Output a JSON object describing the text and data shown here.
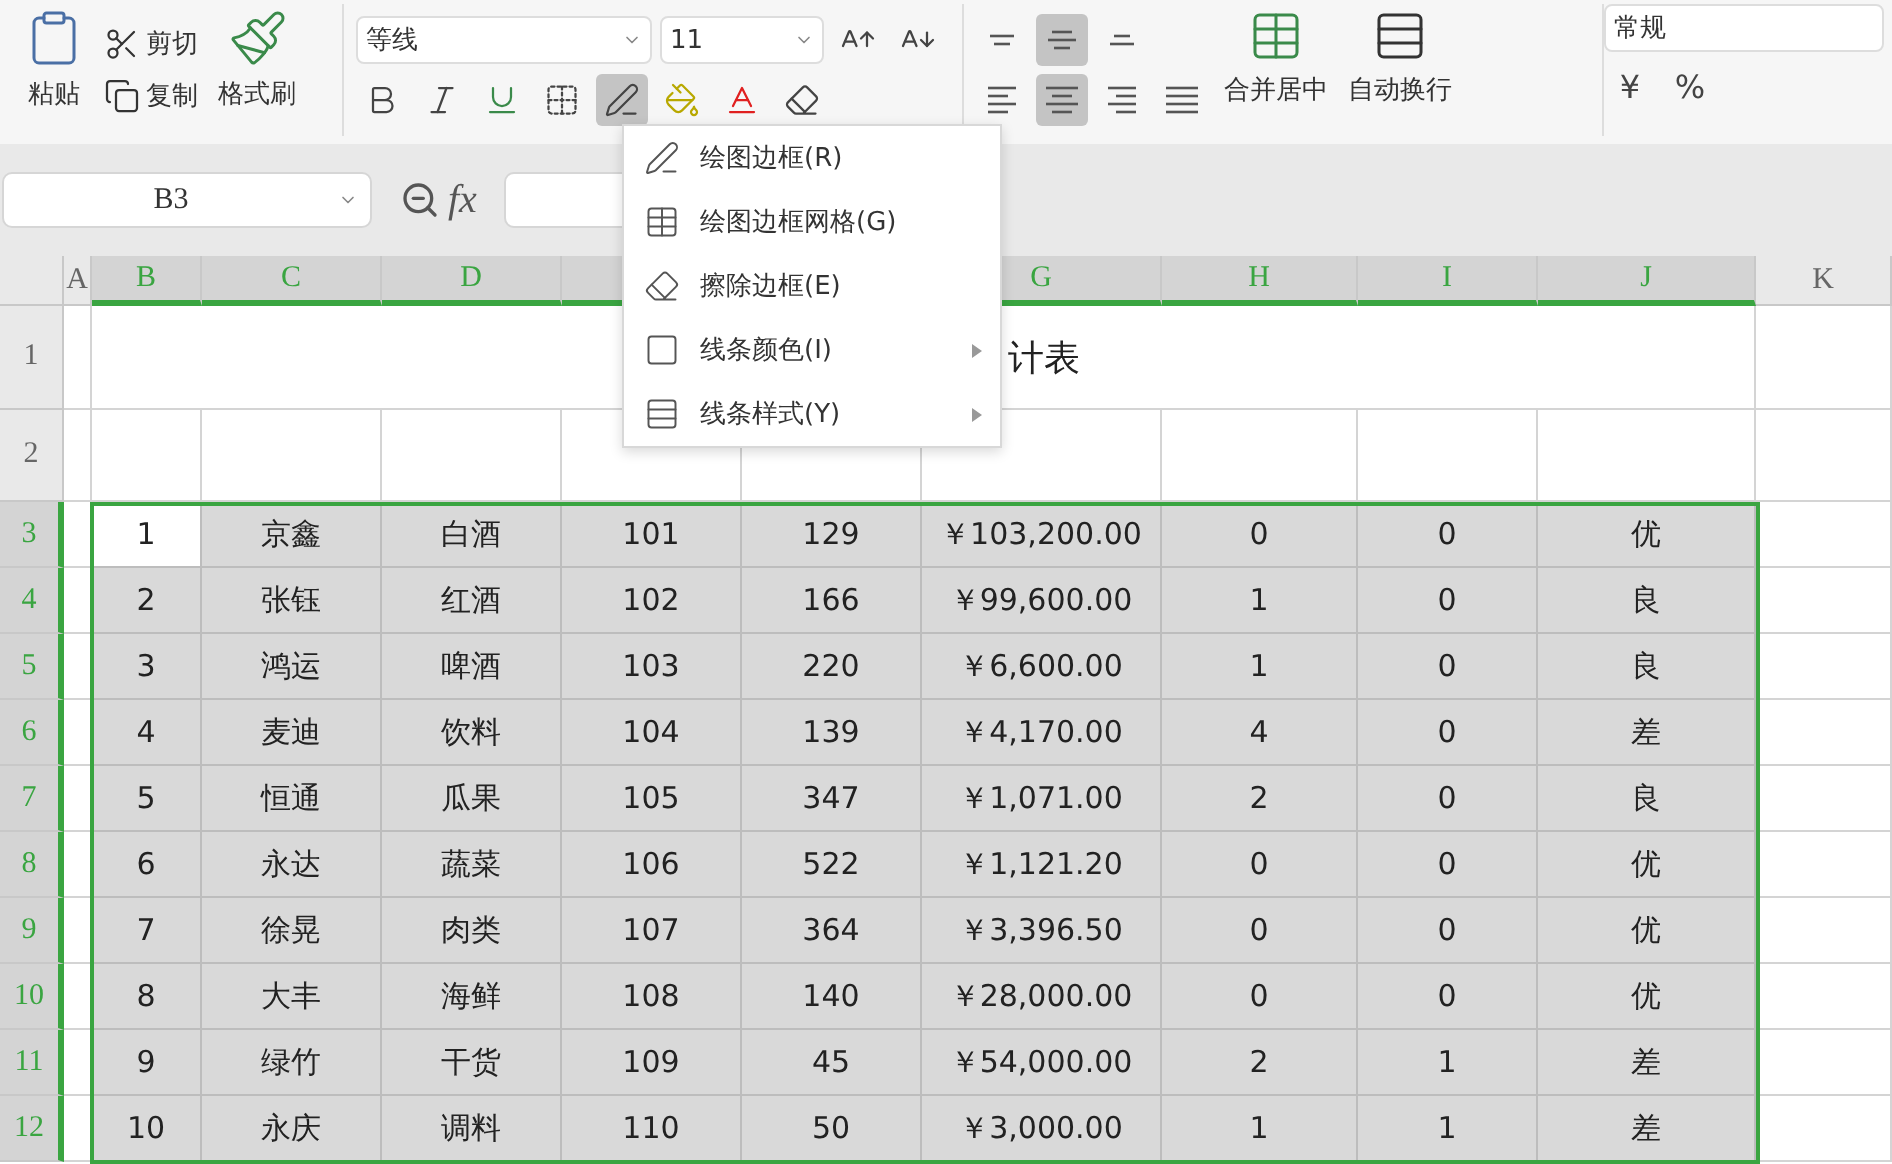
{
  "ribbon": {
    "clipboard": {
      "paste": "粘贴",
      "cut": "剪切",
      "copy": "复制",
      "format_painter": "格式刷"
    },
    "font": {
      "name": "等线",
      "point": "11",
      "border_tool_selected": true
    },
    "alignment": {
      "vertical": [
        {
          "kind": "top",
          "selected": false
        },
        {
          "kind": "middle",
          "selected": true
        },
        {
          "kind": "bottom",
          "selected": false
        }
      ],
      "horizontal": [
        {
          "kind": "left",
          "selected": false
        },
        {
          "kind": "center",
          "selected": true
        },
        {
          "kind": "right",
          "selected": false
        },
        {
          "kind": "justify",
          "selected": false
        }
      ],
      "merge": "合并居中",
      "wrap": "自动换行"
    },
    "number": {
      "format": "常规",
      "currency": "¥",
      "percent": "%"
    }
  },
  "name_box": "B3",
  "formula_label": "fx",
  "border_menu": [
    {
      "label": "绘图边框(R)",
      "kind": "draw",
      "submenu": false
    },
    {
      "label": "绘图边框网格(G)",
      "kind": "grid",
      "submenu": false
    },
    {
      "label": "擦除边框(E)",
      "kind": "erase",
      "submenu": false
    },
    {
      "label": "线条颜色(I)",
      "kind": "color",
      "submenu": true
    },
    {
      "label": "线条样式(Y)",
      "kind": "style",
      "submenu": true
    }
  ],
  "columns": [
    {
      "label": "A",
      "selected": false
    },
    {
      "label": "B",
      "selected": true
    },
    {
      "label": "C",
      "selected": true
    },
    {
      "label": "D",
      "selected": true
    },
    {
      "selected": true
    },
    null,
    {
      "label": "G",
      "selected": true
    },
    {
      "label": "H",
      "selected": true
    },
    {
      "label": "I",
      "selected": true
    },
    {
      "label": "J",
      "selected": true
    },
    {
      "label": "K",
      "selected": false
    }
  ],
  "title": "计表",
  "row_numbers": [
    {
      "label": "1",
      "selected": false
    },
    {
      "label": "2",
      "selected": false
    },
    {
      "label": "3",
      "selected": true
    },
    {
      "label": "4",
      "selected": true
    },
    {
      "label": "5",
      "selected": true
    },
    {
      "label": "6",
      "selected": true
    },
    {
      "label": "7",
      "selected": true
    },
    {
      "label": "8",
      "selected": true
    },
    {
      "label": "9",
      "selected": true
    },
    {
      "label": "10",
      "selected": true
    },
    {
      "label": "11",
      "selected": true
    },
    {
      "label": "12",
      "selected": true
    }
  ],
  "rows": [
    [
      "1",
      "京鑫",
      "白酒",
      "101",
      "129",
      "￥103,200.00",
      "0",
      "0",
      "优"
    ],
    [
      "2",
      "张钰",
      "红酒",
      "102",
      "166",
      "￥99,600.00",
      "1",
      "0",
      "良"
    ],
    [
      "3",
      "鸿运",
      "啤酒",
      "103",
      "220",
      "￥6,600.00",
      "1",
      "0",
      "良"
    ],
    [
      "4",
      "麦迪",
      "饮料",
      "104",
      "139",
      "￥4,170.00",
      "4",
      "0",
      "差"
    ],
    [
      "5",
      "恒通",
      "瓜果",
      "105",
      "347",
      "￥1,071.00",
      "2",
      "0",
      "良"
    ],
    [
      "6",
      "永达",
      "蔬菜",
      "106",
      "522",
      "￥1,121.20",
      "0",
      "0",
      "优"
    ],
    [
      "7",
      "徐晃",
      "肉类",
      "107",
      "364",
      "￥3,396.50",
      "0",
      "0",
      "优"
    ],
    [
      "8",
      "大丰",
      "海鲜",
      "108",
      "140",
      "￥28,000.00",
      "0",
      "0",
      "优"
    ],
    [
      "9",
      "绿竹",
      "干货",
      "109",
      "45",
      "￥54,000.00",
      "2",
      "1",
      "差"
    ],
    [
      "10",
      "永庆",
      "调料",
      "110",
      "50",
      "￥3,000.00",
      "1",
      "1",
      "差"
    ]
  ]
}
